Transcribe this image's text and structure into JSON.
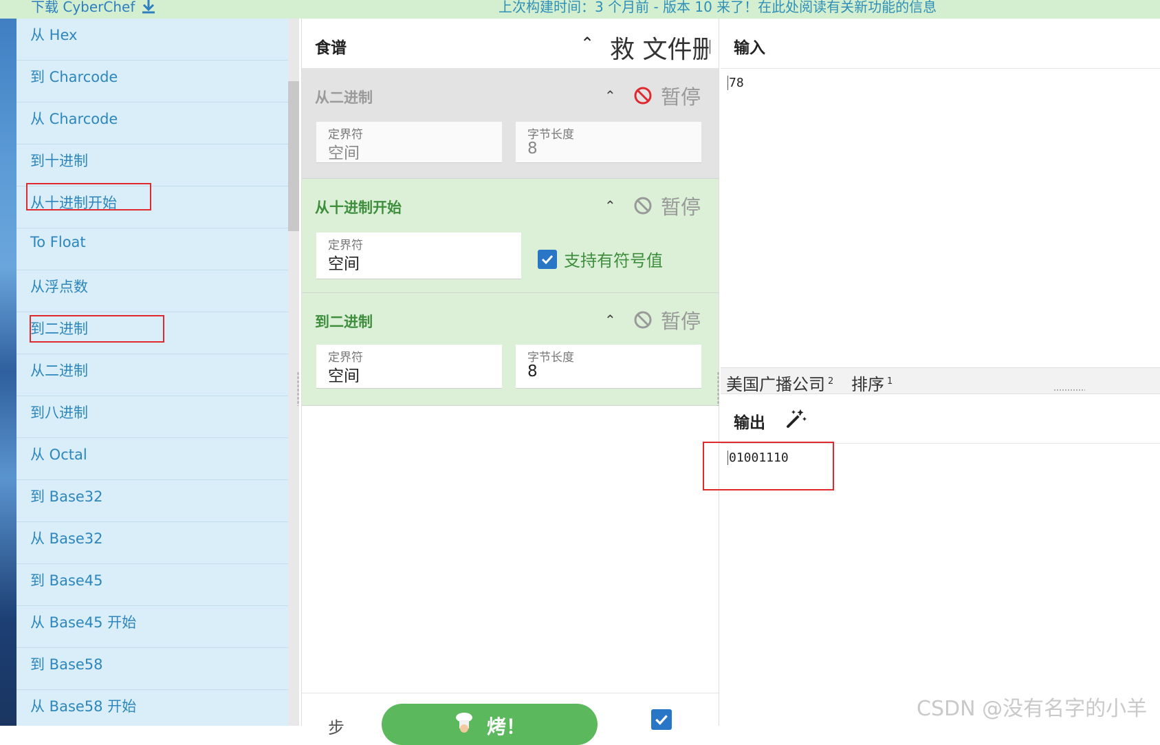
{
  "banner": {
    "download_label": "下载 CyberChef",
    "notice": "上次构建时间：3 个月前 - 版本 10 来了！在此处阅读有关新功能的信息"
  },
  "operations": [
    "从 Hex",
    "到 Charcode",
    "从 Charcode",
    "到十进制",
    "从十进制开始",
    "To Float",
    "从浮点数",
    "到二进制",
    "从二进制",
    "到八进制",
    "从 Octal",
    "到 Base32",
    "从 Base32",
    "到 Base45",
    "从 Base45 开始",
    "到 Base58",
    "从 Base58 开始"
  ],
  "recipe": {
    "title": "食谱",
    "header_buttons": "救 文件删除",
    "steps": [
      {
        "name": "从二进制",
        "state": "disabled",
        "pause_label": "暂停",
        "fields": [
          {
            "label": "定界符",
            "value": "空间"
          },
          {
            "label": "字节长度",
            "value": "8"
          }
        ]
      },
      {
        "name": "从十进制开始",
        "state": "active",
        "pause_label": "暂停",
        "fields": [
          {
            "label": "定界符",
            "value": "空间"
          }
        ],
        "checkbox_label": "支持有符号值",
        "checkbox_checked": true
      },
      {
        "name": "到二进制",
        "state": "active",
        "pause_label": "暂停",
        "fields": [
          {
            "label": "定界符",
            "value": "空间"
          },
          {
            "label": "字节长度",
            "value": "8"
          }
        ]
      }
    ],
    "footer": {
      "step_label": "步",
      "bake_label": "烤！",
      "auto_bake_checked": true
    }
  },
  "input": {
    "title": "输入",
    "value": "78"
  },
  "status": {
    "length_label": "美国广播公司",
    "length_value": "2",
    "lines_label": "排序",
    "lines_value": "1"
  },
  "output": {
    "title": "输出",
    "value": "01001110"
  },
  "watermark": "CSDN @没有名字的小羊",
  "colors": {
    "active_step_bg": "#dbf0d6",
    "disabled_step_bg": "#e3e3e3",
    "ops_bg": "#d9eef8",
    "bake_button": "#5cb85c",
    "highlight_box": "#e0282f"
  }
}
